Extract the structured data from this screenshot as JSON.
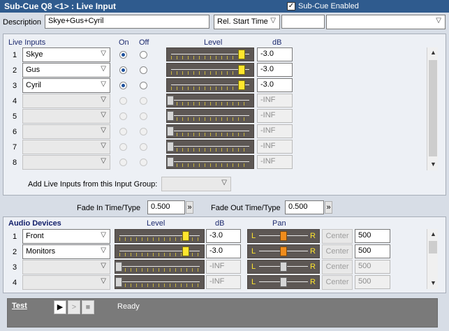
{
  "title": "Sub-Cue Q8 <1> : Live Input",
  "sub_cue_enabled": {
    "label": "Sub-Cue Enabled",
    "checked": true
  },
  "description": {
    "label": "Description",
    "value": "Skye+Gus+Cyril"
  },
  "rel_start_time": {
    "label": "Rel. Start Time",
    "value": ""
  },
  "live_inputs": {
    "header": "Live Inputs",
    "on_label": "On",
    "off_label": "Off",
    "level_label": "Level",
    "db_label": "dB",
    "rows": [
      {
        "num": "1",
        "name": "Skye",
        "on": true,
        "db": "-3.0",
        "level": 0.8,
        "enabled": true
      },
      {
        "num": "2",
        "name": "Gus",
        "on": true,
        "db": "-3.0",
        "level": 0.8,
        "enabled": true
      },
      {
        "num": "3",
        "name": "Cyril",
        "on": true,
        "db": "-3.0",
        "level": 0.8,
        "enabled": true
      },
      {
        "num": "4",
        "name": "",
        "on": false,
        "db": "-INF",
        "level": 0,
        "enabled": false
      },
      {
        "num": "5",
        "name": "",
        "on": false,
        "db": "-INF",
        "level": 0,
        "enabled": false
      },
      {
        "num": "6",
        "name": "",
        "on": false,
        "db": "-INF",
        "level": 0,
        "enabled": false
      },
      {
        "num": "7",
        "name": "",
        "on": false,
        "db": "-INF",
        "level": 0,
        "enabled": false
      },
      {
        "num": "8",
        "name": "",
        "on": false,
        "db": "-INF",
        "level": 0,
        "enabled": false
      }
    ],
    "add_group_label": "Add Live Inputs from this Input Group:",
    "add_group_value": ""
  },
  "fade_in": {
    "label": "Fade In Time/Type",
    "value": "0.500",
    "btn": "»"
  },
  "fade_out": {
    "label": "Fade Out Time/Type",
    "value": "0.500",
    "btn": "»"
  },
  "audio_devices": {
    "header": "Audio Devices",
    "level_label": "Level",
    "db_label": "dB",
    "pan_label": "Pan",
    "pan_l": "L",
    "pan_r": "R",
    "center_label": "Center",
    "rows": [
      {
        "num": "1",
        "name": "Front",
        "db": "-3.0",
        "level": 0.8,
        "pan": "500",
        "enabled": true
      },
      {
        "num": "2",
        "name": "Monitors",
        "db": "-3.0",
        "level": 0.8,
        "pan": "500",
        "enabled": true
      },
      {
        "num": "3",
        "name": "",
        "db": "-INF",
        "level": 0,
        "pan": "500",
        "enabled": false
      },
      {
        "num": "4",
        "name": "",
        "db": "-INF",
        "level": 0,
        "pan": "500",
        "enabled": false
      }
    ]
  },
  "test": {
    "label": "Test",
    "status": "Ready"
  },
  "colors": {
    "title_bg": "#2f5b8e",
    "fader_bg": "#5d5754",
    "knob_active": "#ffe62e",
    "pan_active": "#f08c1c"
  }
}
